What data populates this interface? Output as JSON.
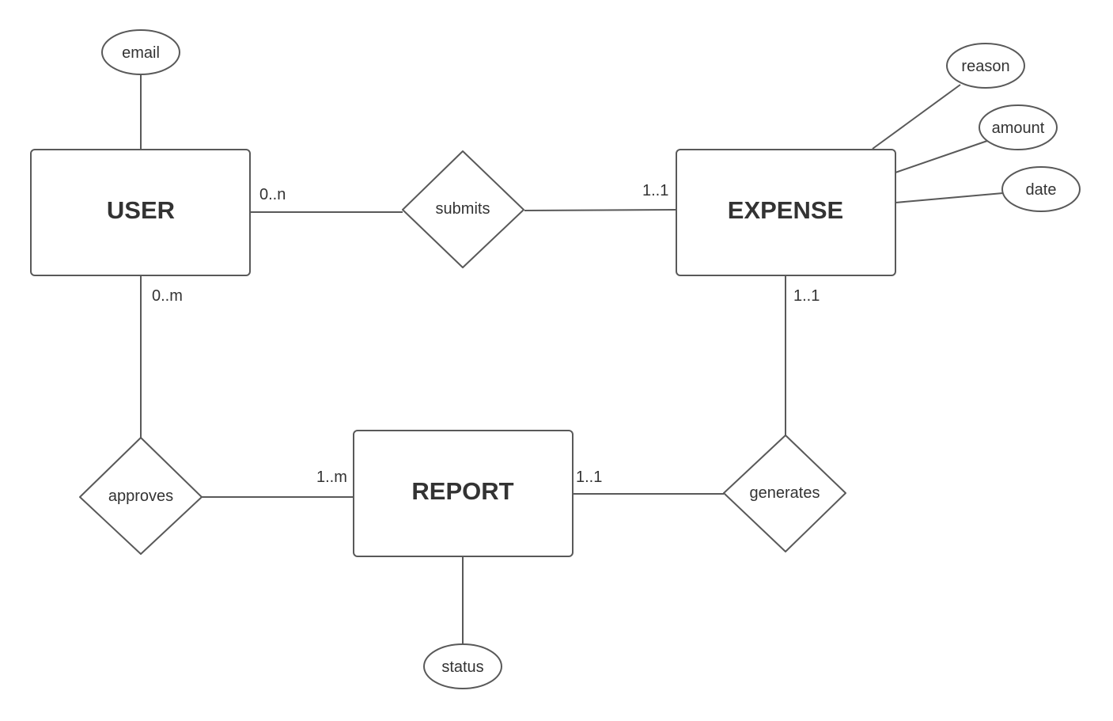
{
  "diagram": {
    "type": "entity-relationship",
    "entities": [
      {
        "id": "user",
        "label": "USER"
      },
      {
        "id": "expense",
        "label": "EXPENSE"
      },
      {
        "id": "report",
        "label": "REPORT"
      }
    ],
    "relationships": [
      {
        "id": "submits",
        "label": "submits",
        "from": "user",
        "to": "expense",
        "from_cardinality": "0..n",
        "to_cardinality": "1..1"
      },
      {
        "id": "approves",
        "label": "approves",
        "from": "user",
        "to": "report",
        "from_cardinality": "0..m",
        "to_cardinality": "1..m"
      },
      {
        "id": "generates",
        "label": "generates",
        "from": "expense",
        "to": "report",
        "from_cardinality": "1..1",
        "to_cardinality": "1..1"
      }
    ],
    "attributes": [
      {
        "id": "email",
        "label": "email",
        "entity": "user"
      },
      {
        "id": "reason",
        "label": "reason",
        "entity": "expense"
      },
      {
        "id": "amount",
        "label": "amount",
        "entity": "expense"
      },
      {
        "id": "date",
        "label": "date",
        "entity": "expense"
      },
      {
        "id": "status",
        "label": "status",
        "entity": "report"
      }
    ]
  },
  "labels": {
    "user": "USER",
    "expense": "EXPENSE",
    "report": "REPORT",
    "submits": "submits",
    "approves": "approves",
    "generates": "generates",
    "email": "email",
    "reason": "reason",
    "amount": "amount",
    "date": "date",
    "status": "status",
    "card_user_submits": "0..n",
    "card_expense_submits": "1..1",
    "card_user_approves": "0..m",
    "card_report_approves": "1..m",
    "card_expense_generates": "1..1",
    "card_report_generates": "1..1"
  }
}
